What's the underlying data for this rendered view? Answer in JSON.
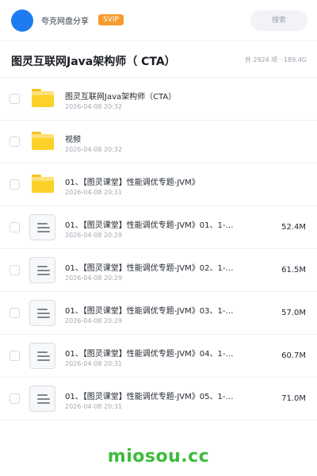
{
  "header": {
    "brand": "夸克网盘分享",
    "badge": "SVIP",
    "search_placeholder": "搜索"
  },
  "title_bar": {
    "title": "图灵互联网Java架构师（ CTA）",
    "summary": "共 2924 项 · 189.4G"
  },
  "files": [
    {
      "kind": "folder",
      "icon": "folder-icon",
      "name": "图灵互联网Java架构师（CTA）",
      "date": "2026-04-08 20:32",
      "size": ""
    },
    {
      "kind": "folder",
      "icon": "folder-icon",
      "name": "视频",
      "date": "2026-04-08 20:32",
      "size": ""
    },
    {
      "kind": "folder",
      "icon": "folder-icon",
      "name": "01、【图灵课堂】性能调优专题-JVM》",
      "date": "2026-04-08 20:31",
      "size": ""
    },
    {
      "kind": "file",
      "icon": "document-icon",
      "name": "01、【图灵课堂】性能调优专题-JVM》01、1-…",
      "date": "2026-04-08 20:29",
      "size": "52.4M"
    },
    {
      "kind": "file",
      "icon": "document-icon",
      "name": "01、【图灵课堂】性能调优专题-JVM》02、1-…",
      "date": "2026-04-08 20:29",
      "size": "61.5M"
    },
    {
      "kind": "file",
      "icon": "document-icon",
      "name": "01、【图灵课堂】性能调优专题-JVM》03、1-…",
      "date": "2026-04-08 20:29",
      "size": "57.0M"
    },
    {
      "kind": "file",
      "icon": "document-icon",
      "name": "01、【图灵课堂】性能调优专题-JVM》04、1-…",
      "date": "2026-04-08 20:31",
      "size": "60.7M"
    },
    {
      "kind": "file",
      "icon": "document-icon",
      "name": "01、【图灵课堂】性能调优专题-JVM》05、1-…",
      "date": "2026-04-08 20:31",
      "size": "71.0M"
    }
  ],
  "watermark": "miosou.cc",
  "colors": {
    "avatar": "#1d7cf2",
    "badge": "#f59b2d",
    "folder": "#fcd12a",
    "watermark": "#3dbb3d"
  }
}
